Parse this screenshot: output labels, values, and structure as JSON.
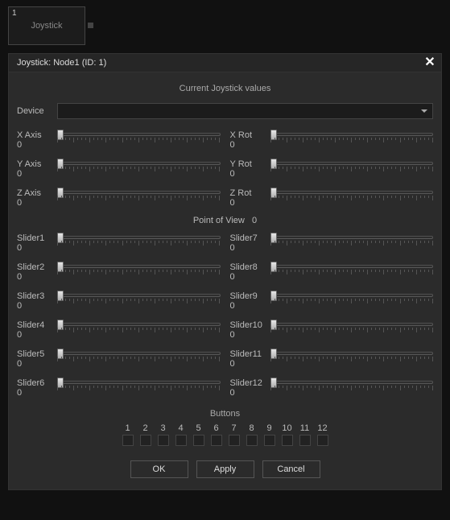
{
  "tab": {
    "index": "1",
    "label": "Joystick"
  },
  "titlebar": {
    "title": "Joystick: Node1 (ID: 1)"
  },
  "section_title": "Current Joystick values",
  "device": {
    "label": "Device",
    "selected": ""
  },
  "axes_left": [
    {
      "name": "X Axis",
      "value": "0"
    },
    {
      "name": "Y Axis",
      "value": "0"
    },
    {
      "name": "Z Axis",
      "value": "0"
    }
  ],
  "axes_right": [
    {
      "name": "X Rot",
      "value": "0"
    },
    {
      "name": "Y Rot",
      "value": "0"
    },
    {
      "name": "Z Rot",
      "value": "0"
    }
  ],
  "pov": {
    "label": "Point of View",
    "value": "0"
  },
  "sliders_left": [
    {
      "name": "Slider1",
      "value": "0"
    },
    {
      "name": "Slider2",
      "value": "0"
    },
    {
      "name": "Slider3",
      "value": "0"
    },
    {
      "name": "Slider4",
      "value": "0"
    },
    {
      "name": "Slider5",
      "value": "0"
    },
    {
      "name": "Slider6",
      "value": "0"
    }
  ],
  "sliders_right": [
    {
      "name": "Slider7",
      "value": "0"
    },
    {
      "name": "Slider8",
      "value": "0"
    },
    {
      "name": "Slider9",
      "value": "0"
    },
    {
      "name": "Slider10",
      "value": "0"
    },
    {
      "name": "Slider11",
      "value": "0"
    },
    {
      "name": "Slider12",
      "value": "0"
    }
  ],
  "buttons_label": "Buttons",
  "joy_buttons": [
    "1",
    "2",
    "3",
    "4",
    "5",
    "6",
    "7",
    "8",
    "9",
    "10",
    "11",
    "12"
  ],
  "dialog": {
    "ok": "OK",
    "apply": "Apply",
    "cancel": "Cancel"
  }
}
